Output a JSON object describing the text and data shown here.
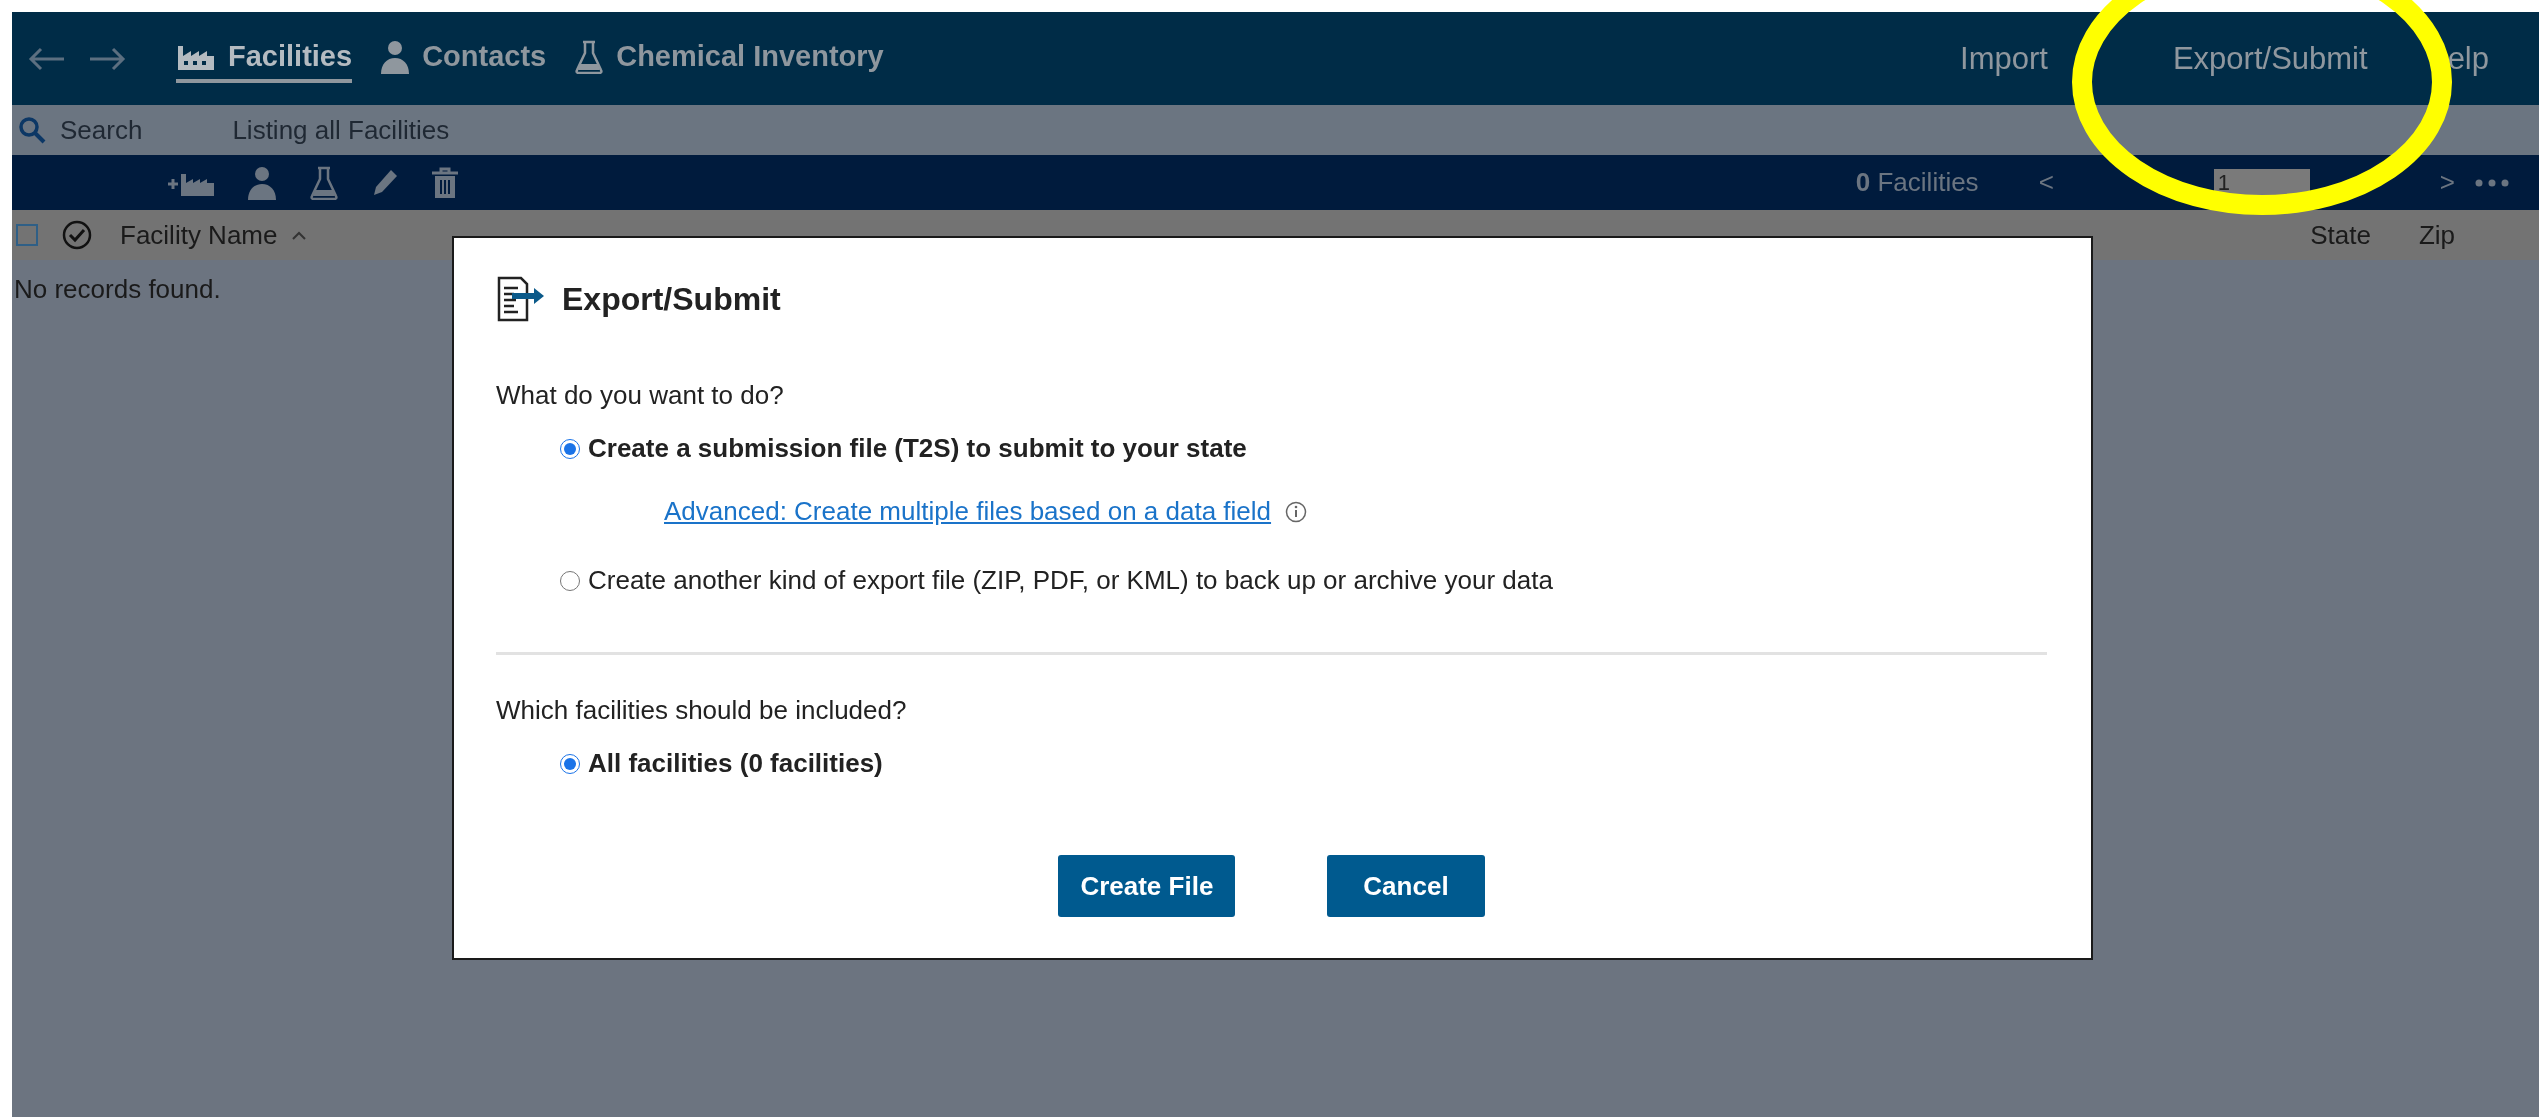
{
  "nav": {
    "tabs": [
      {
        "label": "Facilities",
        "selected": true
      },
      {
        "label": "Contacts",
        "selected": false
      },
      {
        "label": "Chemical Inventory",
        "selected": false
      }
    ],
    "links": [
      "Import",
      "Export/Submit",
      "elp"
    ]
  },
  "search_bar": {
    "label": "Search",
    "status": "Listing all Facilities"
  },
  "toolbar": {
    "count": "0",
    "count_label": "Facilities",
    "prev": "<",
    "page": "1",
    "next": ">"
  },
  "table": {
    "select_all_checked": false,
    "columns": [
      "Facility Name",
      "State",
      "Zip"
    ],
    "empty_message": "No records found."
  },
  "dialog": {
    "title": "Export/Submit",
    "question": "What do you want to do?",
    "options": [
      {
        "label": "Create a submission file (T2S) to submit to your state",
        "selected": true
      },
      {
        "label": "Create another kind of export file (ZIP, PDF, or KML) to back up or archive your data",
        "selected": false
      }
    ],
    "advanced_link": "Advanced: Create multiple files based on a data field",
    "scope_question": "Which facilities should be included?",
    "scope_options": [
      {
        "label": "All facilities (0 facilities)",
        "selected": true
      }
    ],
    "buttons": [
      "Create File",
      "Cancel"
    ]
  },
  "annotation": {
    "kind": "highlight-ring"
  }
}
